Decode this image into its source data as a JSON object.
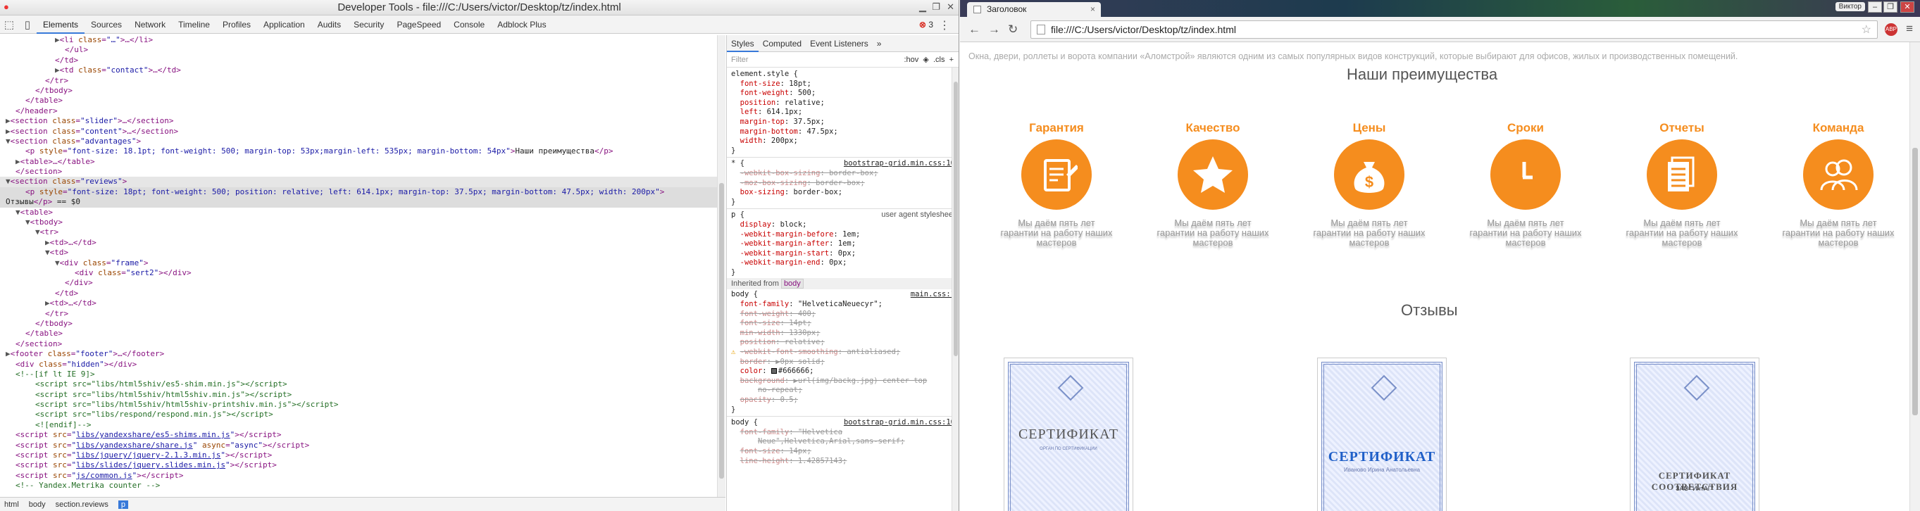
{
  "devtools": {
    "title": "Developer Tools - file:///C:/Users/victor/Desktop/tz/index.html",
    "tabs": [
      "Elements",
      "Sources",
      "Network",
      "Timeline",
      "Profiles",
      "Application",
      "Audits",
      "Security",
      "PageSpeed",
      "Console",
      "Adblock Plus"
    ],
    "active_tab": "Elements",
    "error_count": "3",
    "breadcrumb": [
      "html",
      "body",
      "section.reviews",
      "p"
    ],
    "elements_lines": [
      {
        "i": 5,
        "h": "<span class='arrow'>▶</span><span class='tag'>&lt;li</span> <span class='an'>class</span>=<span class='av'>\"…\"</span><span class='tag'>&gt;</span>…<span class='tag'>&lt;/li&gt;</span>"
      },
      {
        "i": 6,
        "h": "<span class='tag'>&lt;/ul&gt;</span>"
      },
      {
        "i": 5,
        "h": "<span class='tag'>&lt;/td&gt;</span>"
      },
      {
        "i": 5,
        "h": "<span class='arrow'>▶</span><span class='tag'>&lt;td</span> <span class='an'>class</span>=<span class='av'>\"contact\"</span><span class='tag'>&gt;</span>…<span class='tag'>&lt;/td&gt;</span>"
      },
      {
        "i": 4,
        "h": "<span class='tag'>&lt;/tr&gt;</span>"
      },
      {
        "i": 3,
        "h": "<span class='tag'>&lt;/tbody&gt;</span>"
      },
      {
        "i": 2,
        "h": "<span class='tag'>&lt;/table&gt;</span>"
      },
      {
        "i": 1,
        "h": "<span class='tag'>&lt;/header&gt;</span>"
      },
      {
        "i": 0,
        "h": "<span class='arrow'>▶</span><span class='tag'>&lt;section</span> <span class='an'>class</span>=<span class='av'>\"slider\"</span><span class='tag'>&gt;</span>…<span class='tag'>&lt;/section&gt;</span>"
      },
      {
        "i": 0,
        "h": "<span class='arrow'>▶</span><span class='tag'>&lt;section</span> <span class='an'>class</span>=<span class='av'>\"content\"</span><span class='tag'>&gt;</span>…<span class='tag'>&lt;/section&gt;</span>"
      },
      {
        "i": 0,
        "h": "<span class='arrow'>▼</span><span class='tag'>&lt;section</span> <span class='an'>class</span>=<span class='av'>\"advantages\"</span><span class='tag'>&gt;</span>"
      },
      {
        "i": 2,
        "h": "<span class='tag'>&lt;p</span> <span class='an'>style</span>=<span class='av'>\"font-size: 18.1pt; font-weight: 500; margin-top: 53px;margin-left: 535px; margin-bottom: 54px\"</span><span class='tag'>&gt;</span><span class='tx'>Наши преимущества</span><span class='tag'>&lt;/p&gt;</span>"
      },
      {
        "i": 1,
        "h": "<span class='arrow'>▶</span><span class='tag'>&lt;table&gt;</span>…<span class='tag'>&lt;/table&gt;</span>"
      },
      {
        "i": 1,
        "h": "<span class='tag'>&lt;/section&gt;</span>"
      },
      {
        "i": 0,
        "h": "<span class='arrow'>▼</span><span class='tag'>&lt;section</span> <span class='an'>class</span>=<span class='av'>\"reviews\"</span><span class='tag'>&gt;</span>",
        "c": "hl"
      },
      {
        "i": 2,
        "h": "<span class='tag'>&lt;p</span> <span class='an'>style</span>=<span class='av'>\"font-size: 18pt; font-weight: 500; position: relative; left: 614.1px; margin-top: 37.5px; margin-bottom: 47.5px; width: 200px\"</span><span class='tag'>&gt;</span>",
        "c": "sel"
      },
      {
        "i": 0,
        "h": "<span class='tx'>Отзывы</span><span class='tag'>&lt;/p&gt;</span> <span class='tx'>== $0</span>",
        "c": "sel"
      },
      {
        "i": 1,
        "h": "<span class='arrow'>▼</span><span class='tag'>&lt;table&gt;</span>"
      },
      {
        "i": 2,
        "h": "<span class='arrow'>▼</span><span class='tag'>&lt;tbody&gt;</span>"
      },
      {
        "i": 3,
        "h": "<span class='arrow'>▼</span><span class='tag'>&lt;tr&gt;</span>"
      },
      {
        "i": 4,
        "h": "<span class='arrow'>▶</span><span class='tag'>&lt;td&gt;</span>…<span class='tag'>&lt;/td&gt;</span>"
      },
      {
        "i": 4,
        "h": "<span class='arrow'>▼</span><span class='tag'>&lt;td&gt;</span>"
      },
      {
        "i": 5,
        "h": "<span class='arrow'>▼</span><span class='tag'>&lt;div</span> <span class='an'>class</span>=<span class='av'>\"frame\"</span><span class='tag'>&gt;</span>"
      },
      {
        "i": 7,
        "h": "<span class='tag'>&lt;div</span> <span class='an'>class</span>=<span class='av'>\"sert2\"</span><span class='tag'>&gt;&lt;/div&gt;</span>"
      },
      {
        "i": 6,
        "h": "<span class='tag'>&lt;/div&gt;</span>"
      },
      {
        "i": 5,
        "h": "<span class='tag'>&lt;/td&gt;</span>"
      },
      {
        "i": 4,
        "h": "<span class='arrow'>▶</span><span class='tag'>&lt;td&gt;</span>…<span class='tag'>&lt;/td&gt;</span>"
      },
      {
        "i": 4,
        "h": "<span class='tag'>&lt;/tr&gt;</span>"
      },
      {
        "i": 3,
        "h": "<span class='tag'>&lt;/tbody&gt;</span>"
      },
      {
        "i": 2,
        "h": "<span class='tag'>&lt;/table&gt;</span>"
      },
      {
        "i": 1,
        "h": "<span class='tag'>&lt;/section&gt;</span>"
      },
      {
        "i": 0,
        "h": "<span class='arrow'>▶</span><span class='tag'>&lt;footer</span> <span class='an'>class</span>=<span class='av'>\"footer\"</span><span class='tag'>&gt;</span>…<span class='tag'>&lt;/footer&gt;</span>"
      },
      {
        "i": 1,
        "h": "<span class='tag'>&lt;div</span> <span class='an'>class</span>=<span class='av'>\"hidden\"</span><span class='tag'>&gt;&lt;/div&gt;</span>"
      },
      {
        "i": 1,
        "h": "<span class='cm'>&lt;!--[if lt IE 9]&gt;</span>"
      },
      {
        "i": 3,
        "h": "<span class='cm'>&lt;script src=\"libs/html5shiv/es5-shim.min.js\"&gt;&lt;/script&gt;</span>"
      },
      {
        "i": 3,
        "h": "<span class='cm'>&lt;script src=\"libs/html5shiv/html5shiv.min.js\"&gt;&lt;/script&gt;</span>"
      },
      {
        "i": 3,
        "h": "<span class='cm'>&lt;script src=\"libs/html5shiv/html5shiv-printshiv.min.js\"&gt;&lt;/script&gt;</span>"
      },
      {
        "i": 3,
        "h": "<span class='cm'>&lt;script src=\"libs/respond/respond.min.js\"&gt;&lt;/script&gt;</span>"
      },
      {
        "i": 3,
        "h": "<span class='cm'>&lt;![endif]--&gt;</span>"
      },
      {
        "i": 1,
        "h": "<span class='tag'>&lt;script</span> <span class='an'>src</span>=<span class='av'>\"<span class='lk'>libs/yandexshare/es5-shims.min.js</span>\"</span><span class='tag'>&gt;&lt;/script&gt;</span>"
      },
      {
        "i": 1,
        "h": "<span class='tag'>&lt;script</span> <span class='an'>src</span>=<span class='av'>\"<span class='lk'>libs/yandexshare/share.js</span>\"</span> <span class='an'>async</span>=<span class='av'>\"async\"</span><span class='tag'>&gt;&lt;/script&gt;</span>"
      },
      {
        "i": 1,
        "h": "<span class='tag'>&lt;script</span> <span class='an'>src</span>=<span class='av'>\"<span class='lk'>libs/jquery/jquery-2.1.3.min.js</span>\"</span><span class='tag'>&gt;&lt;/script&gt;</span>"
      },
      {
        "i": 1,
        "h": "<span class='tag'>&lt;script</span> <span class='an'>src</span>=<span class='av'>\"<span class='lk'>libs/slides/jquery.slides.min.js</span>\"</span><span class='tag'>&gt;&lt;/script&gt;</span>"
      },
      {
        "i": 1,
        "h": "<span class='tag'>&lt;script</span> <span class='an'>src</span>=<span class='av'>\"<span class='lk'>js/common.js</span>\"</span><span class='tag'>&gt;&lt;/script&gt;</span>"
      },
      {
        "i": 1,
        "h": "<span class='cm'>&lt;!-- Yandex.Metrika counter --&gt;</span>"
      }
    ],
    "styles": {
      "tabs": [
        "Styles",
        "Computed",
        "Event Listeners"
      ],
      "filter_placeholder": "Filter",
      "filter_tools": ":hov  ◈  .cls  +",
      "inherited_from": "Inherited from",
      "inherited_tag": "body",
      "rows": [
        {
          "h": "<span class='sel-n'>element.style {</span>"
        },
        {
          "h": "  <span class='pn'>font-size</span>: <span class='pv'>18pt;</span>"
        },
        {
          "h": "  <span class='pn'>font-weight</span>: <span class='pv'>500;</span>"
        },
        {
          "h": "  <span class='pn'>position</span>: <span class='pv'>relative;</span>"
        },
        {
          "h": "  <span class='pn'>left</span>: <span class='pv'>614.1px;</span>"
        },
        {
          "h": "  <span class='pn'>margin-top</span>: <span class='pv'>37.5px;</span>"
        },
        {
          "h": "  <span class='pn'>margin-bottom</span>: <span class='pv'>47.5px;</span>"
        },
        {
          "h": "  <span class='pn'>width</span>: <span class='pv'>200px;</span>"
        },
        {
          "h": "}"
        },
        {
          "sep": true
        },
        {
          "h": "<span class='sel-n'>* {</span>",
          "src": "bootstrap-grid.min.css:10"
        },
        {
          "h": "  <span class='strike'><span class='pn'>-webkit-box-sizing</span>: border-box;</span>"
        },
        {
          "h": "  <span class='strike'><span class='pn'>-moz-box-sizing</span>: border-box;</span>"
        },
        {
          "h": "  <span class='pn'>box-sizing</span>: <span class='pv'>border-box;</span>"
        },
        {
          "h": "}"
        },
        {
          "sep": true
        },
        {
          "h": "<span class='sel-n'>p {</span>",
          "ua": "user agent stylesheet"
        },
        {
          "h": "  <span class='pn'>display</span>: <span class='pv'>block;</span>"
        },
        {
          "h": "  <span class='pn'>-webkit-margin-before</span>: <span class='pv'>1em;</span>"
        },
        {
          "h": "  <span class='pn'>-webkit-margin-after</span>: <span class='pv'>1em;</span>"
        },
        {
          "h": "  <span class='pn'>-webkit-margin-start</span>: <span class='pv'>0px;</span>"
        },
        {
          "h": "  <span class='pn'>-webkit-margin-end</span>: <span class='pv'>0px;</span>"
        },
        {
          "h": "}"
        },
        {
          "inh": true
        },
        {
          "h": "<span class='sel-n'>body {</span>",
          "src": "main.css:1"
        },
        {
          "h": "  <span class='pn'>font-family</span>: <span class='pv'>\"HelveticaNeuecyr\";</span>"
        },
        {
          "h": "  <span class='strike'><span class='pn'>font-weight</span>: 400;</span>"
        },
        {
          "h": "  <span class='strike'><span class='pn'>font-size</span>: 14pt;</span>"
        },
        {
          "h": "  <span class='strike'><span class='pn'>min-width</span>: 1330px;</span>"
        },
        {
          "h": "  <span class='strike'><span class='pn'>position</span>: relative;</span>"
        },
        {
          "h": "<span class='warn'>⚠</span> <span class='strike'><span class='pn'>-webkit-font-smoothing</span>: antialiased;</span>"
        },
        {
          "h": "  <span class='strike'><span class='pn'>border</span>: ▶0px solid;</span>"
        },
        {
          "h": "  <span class='pn'>color</span>: <span class='sw'></span><span class='pv'>#666666;</span>"
        },
        {
          "h": "  <span class='strike'><span class='pn'>background</span>: ▶url(img/backg.jpg) center top</span>"
        },
        {
          "h": "      <span class='strike'>no-repeat;</span>"
        },
        {
          "h": "  <span class='strike'><span class='pn'>opacity</span>: 0.5;</span>"
        },
        {
          "h": "}"
        },
        {
          "sep": true
        },
        {
          "h": "<span class='sel-n'>body {</span>",
          "src": "bootstrap-grid.min.css:10"
        },
        {
          "h": "  <span class='strike'><span class='pn'>font-family</span>: \"Helvetica</span>"
        },
        {
          "h": "      <span class='strike'>Neue\",Helvetica,Arial,sans-serif;</span>"
        },
        {
          "h": "  <span class='strike'><span class='pn'>font-size</span>: 14px;</span>"
        },
        {
          "h": "  <span class='strike'><span class='pn'>line-height</span>: 1.42857143;</span>"
        }
      ]
    }
  },
  "browser": {
    "tab_title": "Заголовок",
    "tab_close": "×",
    "user_label": "Виктор",
    "url": "file:///C:/Users/victor/Desktop/tz/index.html",
    "ext_label": "ABP",
    "page": {
      "intro": "Окна, двери, роллеты и ворота компании «Аломстрой» являются одним из самых популярных видов конструкций, которые выбирают для офисов, жилых и производственных помещений.",
      "advantages_title": "Наши преимущества",
      "advantages": [
        {
          "label": "Гарантия",
          "icon": "guarantee-icon",
          "desc": "Мы даём пять лет гарантии на работу наших мастеров"
        },
        {
          "label": "Качество",
          "icon": "star-icon",
          "desc": "Мы даём пять лет гарантии на работу наших мастеров"
        },
        {
          "label": "Цены",
          "icon": "money-bag-icon",
          "desc": "Мы даём пять лет гарантии на работу наших мастеров"
        },
        {
          "label": "Сроки",
          "icon": "clock-icon",
          "desc": "Мы даём пять лет гарантии на работу наших мастеров"
        },
        {
          "label": "Отчеты",
          "icon": "document-icon",
          "desc": "Мы даём пять лет гарантии на работу наших мастеров"
        },
        {
          "label": "Команда",
          "icon": "team-icon",
          "desc": "Мы даём пять лет гарантии на работу наших мастеров"
        }
      ],
      "reviews_title": "Отзывы",
      "certificates": [
        {
          "title": "СЕРТИФИКАТ",
          "sub": "ОРГАН ПО СЕРТИФИКАЦИИ"
        },
        {
          "title": "СЕРТИФИКАТ",
          "sub": "Иваново Ирина Анатольевна"
        },
        {
          "title": "СЕРТИФИКАТ СООТВЕТСТВИЯ",
          "sub": "ЗАО \"ИнтАГ\""
        }
      ]
    },
    "accent_color": "#f58d1e"
  }
}
